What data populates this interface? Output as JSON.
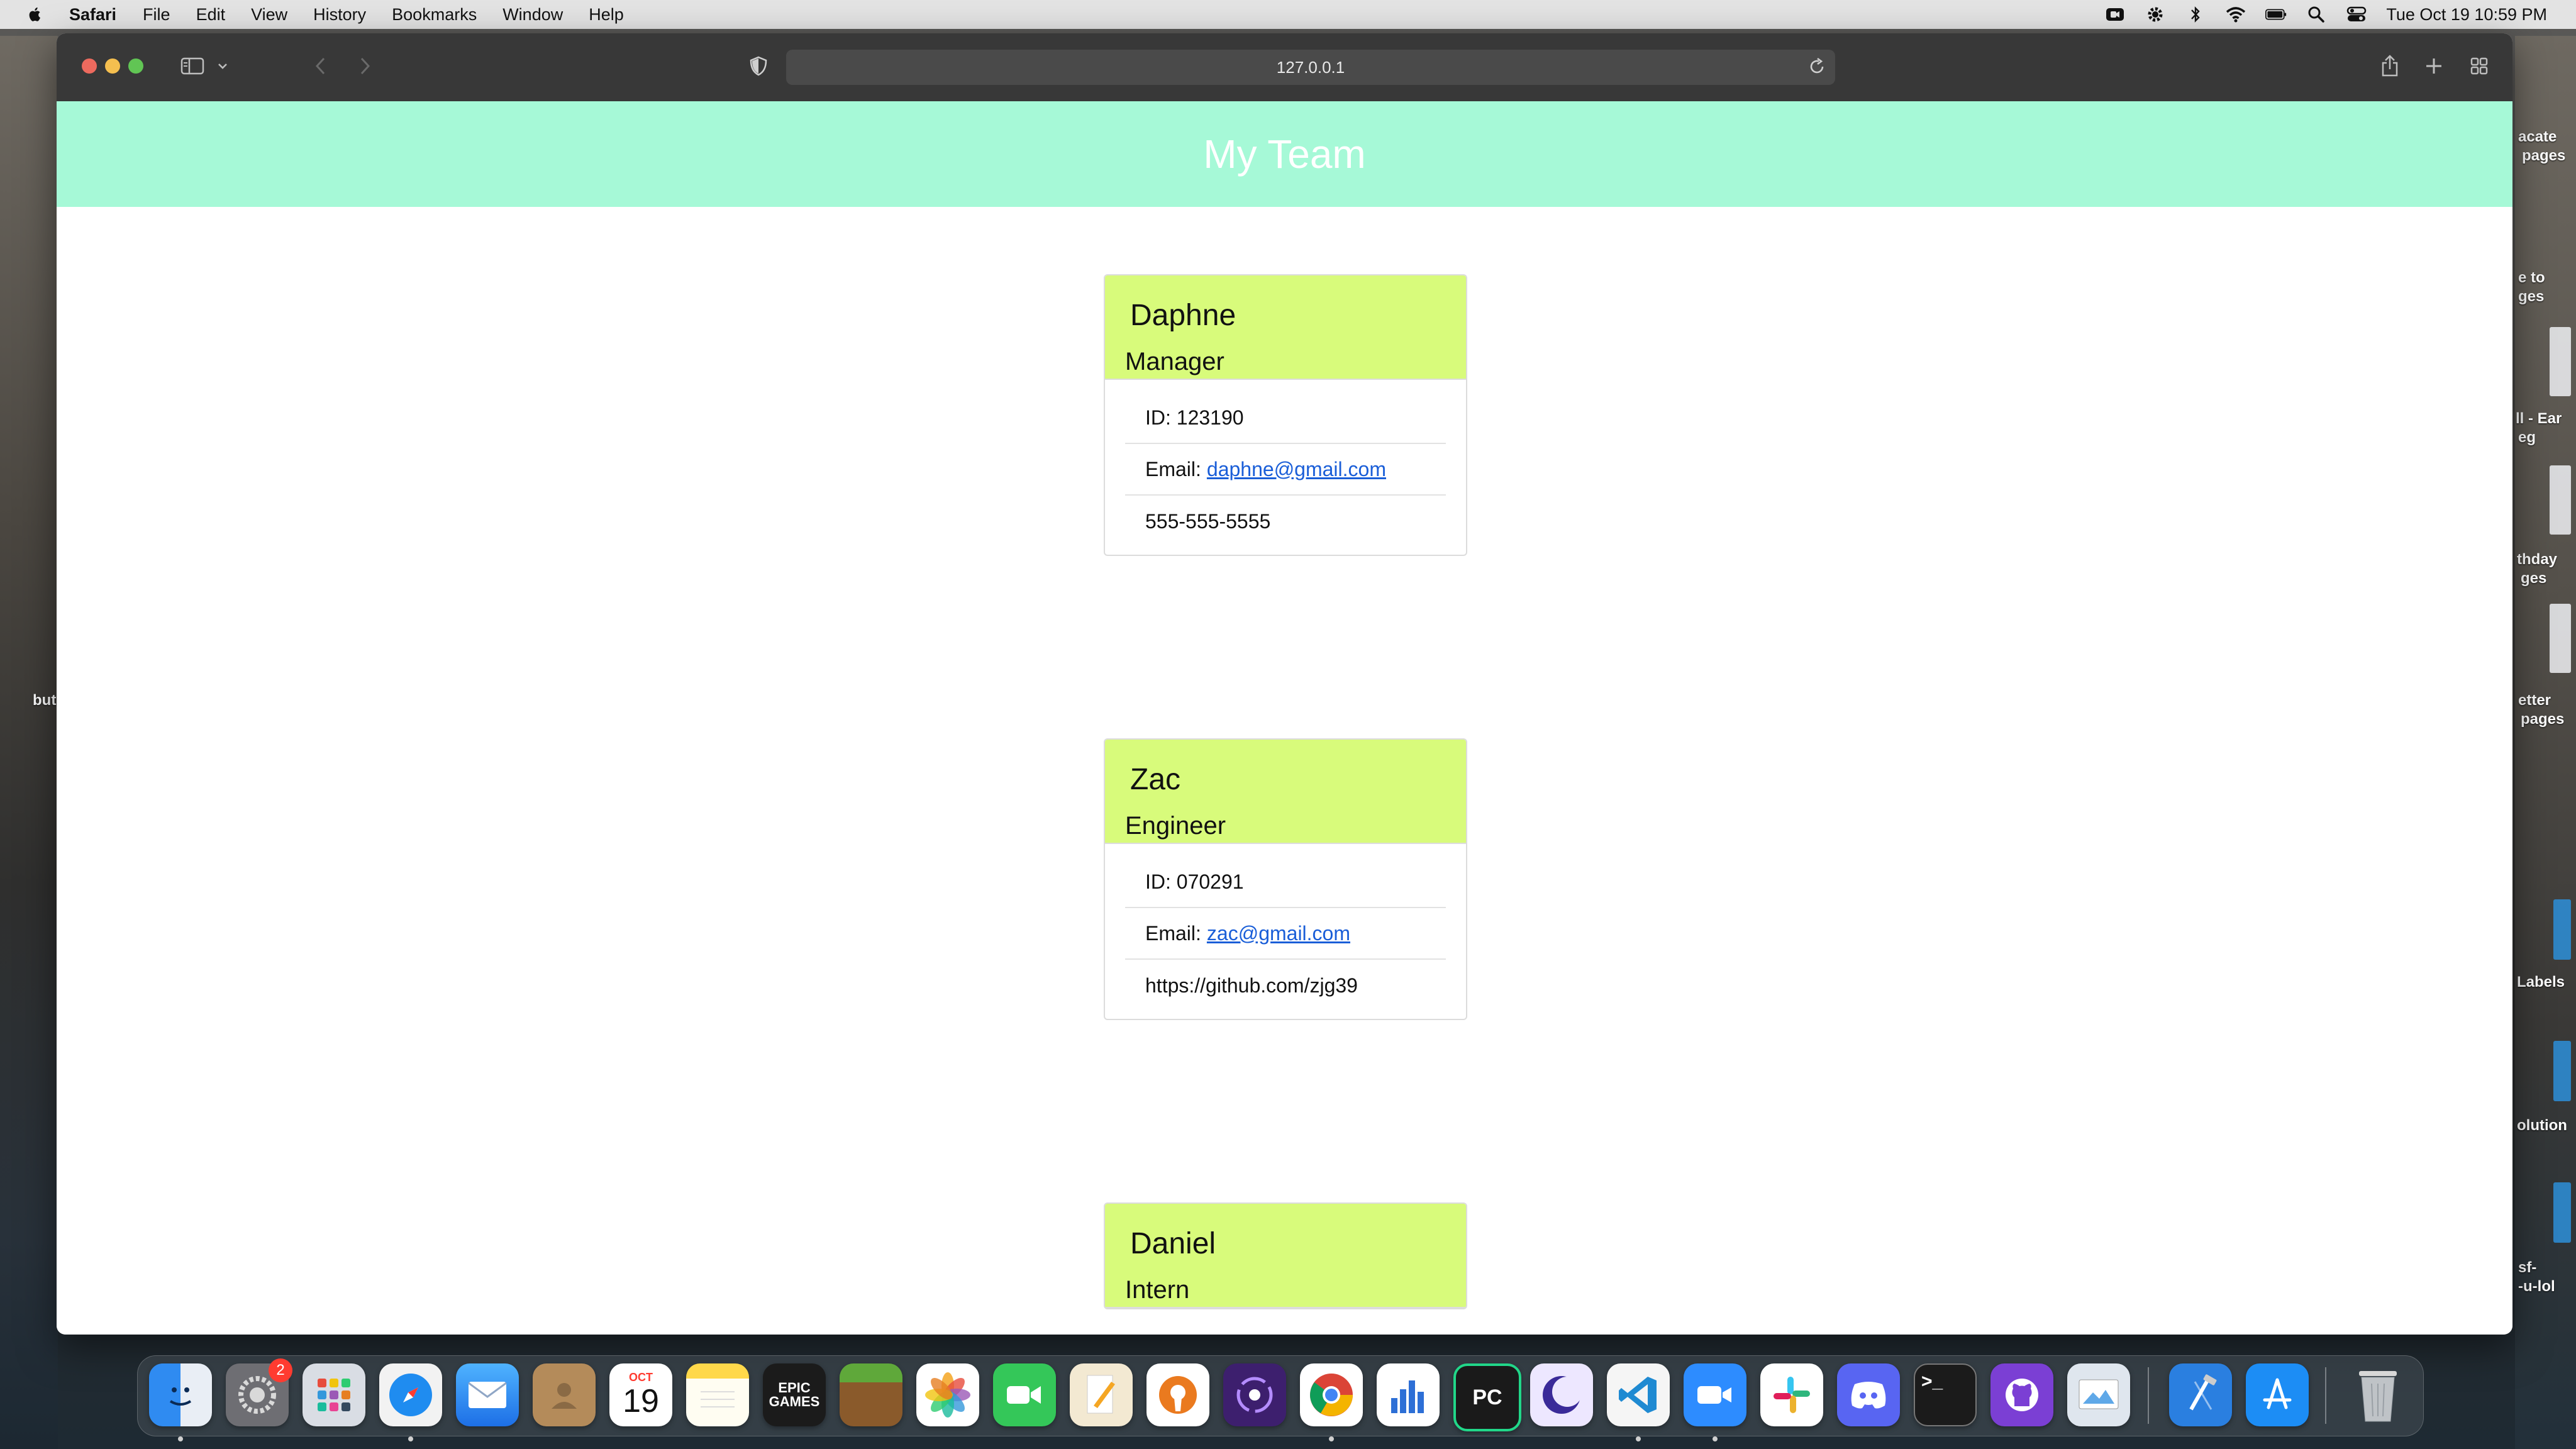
{
  "menubar": {
    "app_name": "Safari",
    "items": [
      "File",
      "Edit",
      "View",
      "History",
      "Bookmarks",
      "Window",
      "Help"
    ],
    "datetime": "Tue Oct 19  10:59 PM"
  },
  "browser": {
    "url": "127.0.0.1"
  },
  "page": {
    "title": "My Team",
    "cards": [
      {
        "name": "Daphne",
        "role": "Manager",
        "id_text": "ID: 123190",
        "email_label": "Email:",
        "email": "daphne@gmail.com",
        "extra": "555-555-5555"
      },
      {
        "name": "Zac",
        "role": "Engineer",
        "id_text": "ID: 070291",
        "email_label": "Email:",
        "email": "zac@gmail.com",
        "extra": "https://github.com/zjg39"
      },
      {
        "name": "Daniel",
        "role": "Intern"
      }
    ]
  },
  "desktop": {
    "labels_right": [
      "acate",
      "pages",
      "e to",
      "ges",
      "ll - Ear",
      "eg",
      "thday",
      "ges",
      "etter",
      "pages",
      "Labels",
      "olution",
      "sf-",
      "-u-lol"
    ],
    "label_left": "but"
  },
  "dock": {
    "calendar_month": "OCT",
    "calendar_day": "19",
    "settings_badge": "2",
    "epic_text": "EPIC GAMES",
    "pycharm_text": "PC",
    "terminal_text": ">_"
  }
}
